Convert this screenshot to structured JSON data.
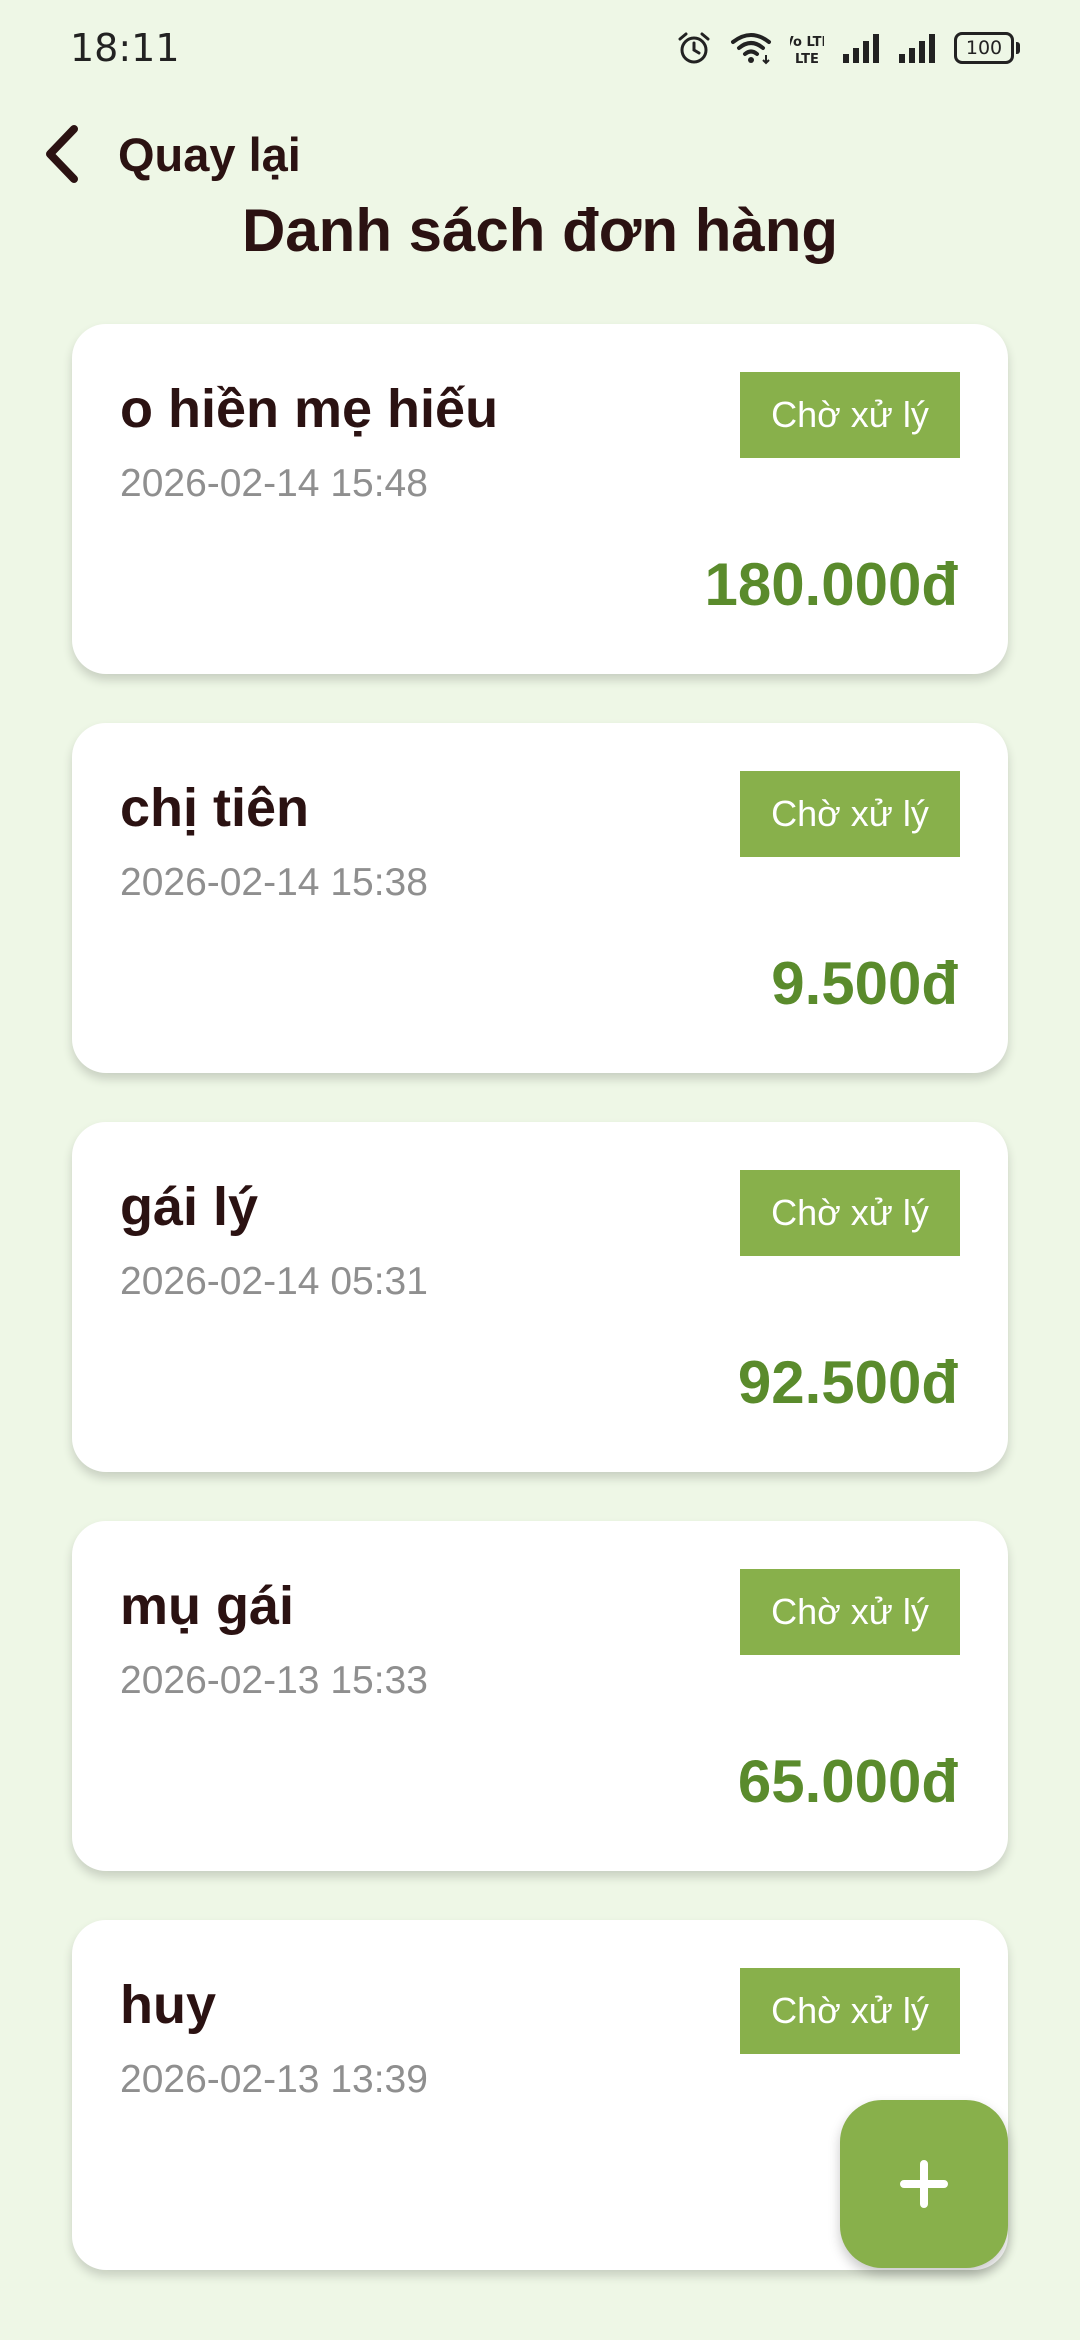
{
  "status_bar": {
    "time": "18:11",
    "volte_label": "Vo LTE",
    "battery_level": "100",
    "icons": [
      "alarm-icon",
      "wifi-icon",
      "volte-icon",
      "signal-icon",
      "signal-icon",
      "battery-icon"
    ]
  },
  "header": {
    "back_label": "Quay lại",
    "back_icon": "chevron-left-icon",
    "title": "Danh sách đơn hàng"
  },
  "orders": [
    {
      "name": "o hiền mẹ hiếu",
      "date": "2026-02-14 15:48",
      "status": "Chờ xử lý",
      "amount": "180.000đ"
    },
    {
      "name": "chị tiên",
      "date": "2026-02-14 15:38",
      "status": "Chờ xử lý",
      "amount": "9.500đ"
    },
    {
      "name": "gái lý",
      "date": "2026-02-14 05:31",
      "status": "Chờ xử lý",
      "amount": "92.500đ"
    },
    {
      "name": "mụ gái",
      "date": "2026-02-13 15:33",
      "status": "Chờ xử lý",
      "amount": "65.000đ"
    },
    {
      "name": "huy",
      "date": "2026-02-13 13:39",
      "status": "Chờ xử lý",
      "amount": ""
    }
  ],
  "fab": {
    "icon": "plus-icon"
  },
  "colors": {
    "background": "#eef7e6",
    "accent": "#88b04b",
    "amount": "#5a8b2c",
    "text": "#2b1212",
    "muted": "#8f8f8f"
  }
}
